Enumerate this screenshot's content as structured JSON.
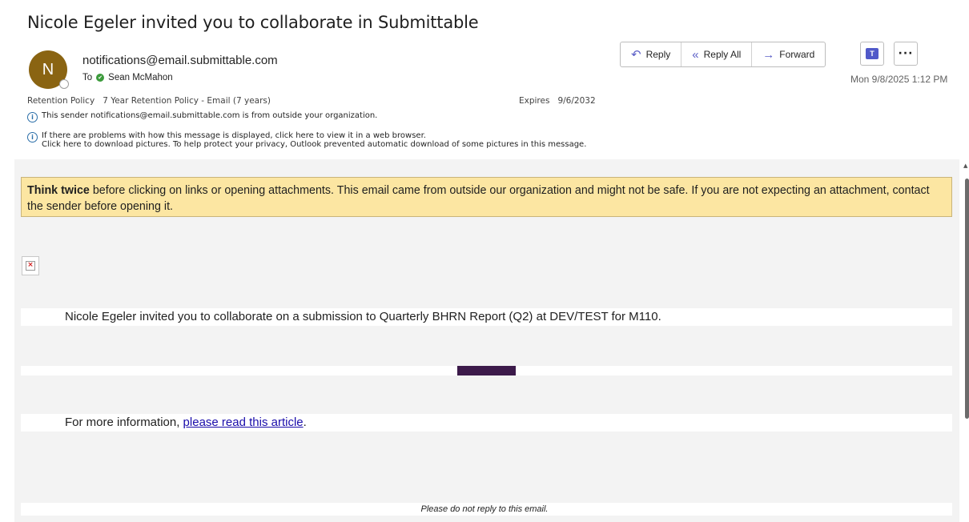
{
  "subject": "Nicole Egeler invited you to collaborate in Submittable",
  "sender": {
    "avatar_initial": "N",
    "email": "notifications@email.submittable.com",
    "to_label": "To",
    "recipient": "Sean McMahon"
  },
  "toolbar": {
    "reply_label": "Reply",
    "reply_all_label": "Reply All",
    "forward_label": "Forward",
    "more_label": "···"
  },
  "date": "Mon 9/8/2025 1:12 PM",
  "retention": {
    "label": "Retention Policy",
    "value": "7 Year Retention Policy - Email (7 years)",
    "expires_label": "Expires",
    "expires_value": "9/6/2032"
  },
  "notices": {
    "external_sender": "This sender notifications@email.submittable.com is from outside your organization.",
    "display_problem": "If there are problems with how this message is displayed, click here to view it in a web browser.",
    "download_pictures": "Click here to download pictures. To help protect your privacy, Outlook prevented automatic download of some pictures in this message."
  },
  "warning": {
    "bold": "Think twice",
    "text": " before clicking on links or opening attachments. This email came from outside our organization and might not be safe. If you are not expecting an attachment, contact the sender before opening it."
  },
  "body": {
    "invite_text": "Nicole Egeler invited you to collaborate on a submission to Quarterly BHRN Report (Q2) at DEV/TEST for M110.",
    "more_info_prefix": "For more information, ",
    "more_info_link": "please read this article",
    "more_info_suffix": ".",
    "footer": "Please do not reply to this email."
  },
  "colors": {
    "avatar": "#8a6412",
    "warning_bg": "#fce6a2",
    "accent_bar": "#3c1a4a",
    "link": "#1a0dab"
  }
}
